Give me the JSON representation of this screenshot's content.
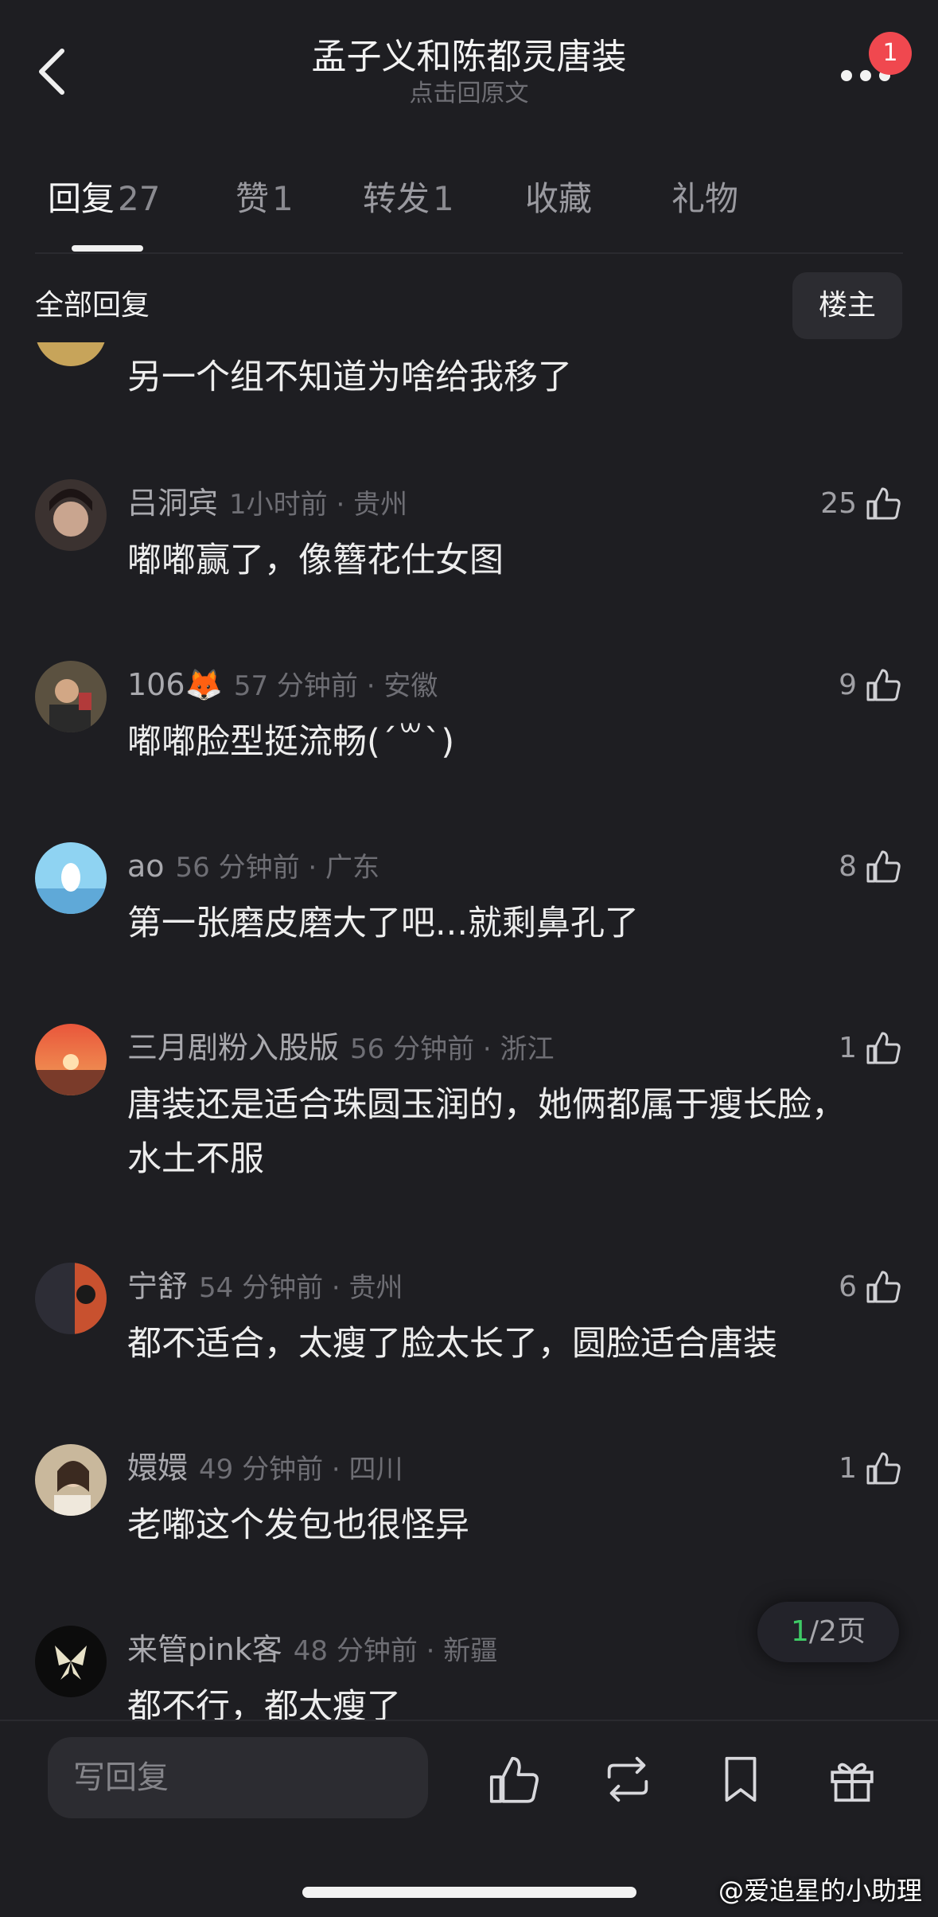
{
  "header": {
    "title": "孟子义和陈都灵唐装",
    "subtitle": "点击回原文",
    "notification_count": "1",
    "back_icon": "chevron-left-icon",
    "more_icon": "more-dots-icon"
  },
  "tabs": [
    {
      "label": "回复",
      "count": "27",
      "active": true
    },
    {
      "label": "赞",
      "count": "1"
    },
    {
      "label": "转发",
      "count": "1"
    },
    {
      "label": "收藏",
      "count": ""
    },
    {
      "label": "礼物",
      "count": ""
    }
  ],
  "section": {
    "title": "全部回复",
    "op_button": "楼主"
  },
  "partial_comment": {
    "text": "另一个组不知道为啥给我移了"
  },
  "comments": [
    {
      "name": "吕洞宾",
      "time": "1小时前 · 贵州",
      "likes": "25",
      "text": "嘟嘟赢了，像簪花仕女图",
      "avatar_color": "#5a4a46"
    },
    {
      "name": "106🦊",
      "time": "57 分钟前 · 安徽",
      "likes": "9",
      "text": "嘟嘟脸型挺流畅(´꒳`)",
      "avatar_color": "#4b4434"
    },
    {
      "name": "ao",
      "time": "56 分钟前 · 广东",
      "likes": "8",
      "text": "第一张磨皮磨大了吧...就剩鼻孔了",
      "avatar_color": "#7cc6ea"
    },
    {
      "name": "三月剧粉入股版",
      "time": "56 分钟前 · 浙江",
      "likes": "1",
      "text": "唐装还是适合珠圆玉润的，她俩都属于瘦长脸，水土不服",
      "avatar_color": "#e0703a"
    },
    {
      "name": "宁舒",
      "time": "54 分钟前 · 贵州",
      "likes": "6",
      "text": "都不适合，太瘦了脸太长了，圆脸适合唐装",
      "avatar_color": "#3a3a44"
    },
    {
      "name": "嬛嬛",
      "time": "49 分钟前 · 四川",
      "likes": "1",
      "text": "老嘟这个发包也很怪异",
      "avatar_color": "#b6a58c"
    },
    {
      "name": "来管pink客",
      "time": "48 分钟前 · 新疆",
      "likes": "",
      "text": "都不行，都太瘦了",
      "avatar_color": "#111111"
    }
  ],
  "pagination": {
    "current": "1",
    "total_text": "/2页"
  },
  "bottom_bar": {
    "placeholder": "写回复",
    "icons": [
      "thumbs-up-icon",
      "repost-icon",
      "bookmark-icon",
      "gift-icon"
    ]
  },
  "watermark": "@爱追星的小助理"
}
